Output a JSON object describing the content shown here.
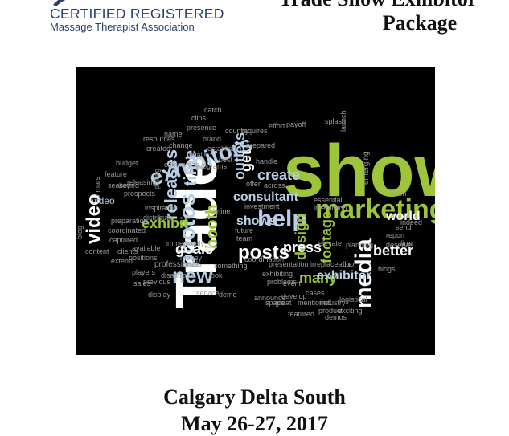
{
  "header": {
    "logo_line1": "CERTIFIED REGISTERED",
    "logo_line2": "Massage Therapist Association",
    "title_line1": "Trade Show Exhibitor",
    "title_line2": "Package"
  },
  "word_cloud": {
    "words": [
      "show",
      "Trade",
      "marketing",
      "exhibitors",
      "help",
      "posts",
      "media",
      "photos",
      "video",
      "releases",
      "new",
      "exhibit",
      "booth",
      "time",
      "design",
      "footage",
      "consultant",
      "create",
      "press",
      "better",
      "goals",
      "get",
      "outlets",
      "many",
      "exhibitor",
      "world",
      "shows",
      "content",
      "blog",
      "planning",
      "seen",
      "video",
      "emerging",
      "clips",
      "catch",
      "presence",
      "resources",
      "created",
      "budget",
      "feature",
      "prepared",
      "effort",
      "preparation",
      "coordinated",
      "captured",
      "professionals",
      "extend",
      "players",
      "previous",
      "display",
      "sales",
      "demo",
      "service",
      "event",
      "cases",
      "develop",
      "mentioned",
      "featured",
      "industry",
      "product",
      "logistical",
      "exciting",
      "demos",
      "blogs",
      "coordination",
      "presentation",
      "exhibiting",
      "problems",
      "space",
      "great",
      "announce",
      "investment",
      "interaction",
      "essential",
      "payoff",
      "splash",
      "launch",
      "offer",
      "across",
      "define",
      "future",
      "team",
      "handle",
      "irreplaceable",
      "floor",
      "elevate",
      "report",
      "send",
      "firm",
      "indeed",
      "deserve",
      "something",
      "look",
      "money",
      "immediately",
      "releasing",
      "prospects",
      "seasoned",
      "key",
      "formats",
      "companies",
      "details",
      "change",
      "name",
      "brand",
      "country",
      "requires",
      "establish",
      "best",
      "programs",
      "pulling",
      "inspiration",
      "distribute",
      "available",
      "positions",
      "disastrous",
      "clients"
    ],
    "colors": {
      "green": "#9ec43a",
      "white": "#ffffff",
      "light_blue": "#b8cfe6",
      "gray": "#9a9a9a"
    }
  },
  "event": {
    "venue": "Calgary Delta South",
    "dates": "May 26-27, 2017"
  }
}
